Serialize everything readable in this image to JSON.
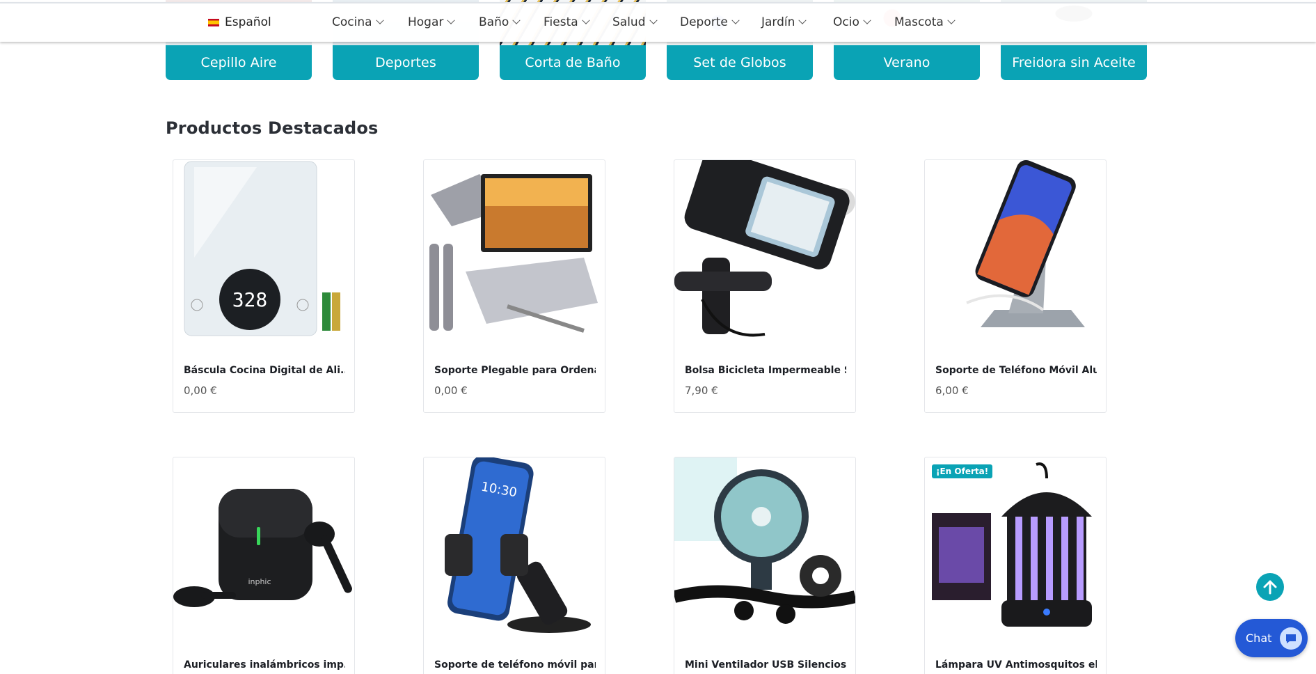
{
  "nav": {
    "language": "Español",
    "items": [
      {
        "label": "Cocina"
      },
      {
        "label": "Hogar"
      },
      {
        "label": "Baño"
      },
      {
        "label": "Fiesta"
      },
      {
        "label": "Salud"
      },
      {
        "label": "Deporte"
      },
      {
        "label": "Jardín"
      },
      {
        "label": "Ocio"
      },
      {
        "label": "Mascota"
      }
    ]
  },
  "categories": [
    {
      "label": "Cepillo Aire"
    },
    {
      "label": "Deportes"
    },
    {
      "label": "Corta de Baño"
    },
    {
      "label": "Set de Globos"
    },
    {
      "label": "Verano"
    },
    {
      "label": "Freidora sin Aceite"
    }
  ],
  "featured": {
    "title": "Productos Destacados",
    "products": [
      {
        "name": "Báscula Cocina Digital de Ali...",
        "price": "0,00 €",
        "icon": "kitchen-scale-image"
      },
      {
        "name": "Soporte Plegable para Ordena...",
        "price": "0,00 €",
        "icon": "laptop-stand-image"
      },
      {
        "name": "Bolsa Bicicleta Impermeable S...",
        "price": "7,90 €",
        "icon": "bike-phone-bag-image"
      },
      {
        "name": "Soporte de Teléfono Móvil Alu...",
        "price": "6,00 €",
        "icon": "phone-stand-image"
      },
      {
        "name": "Auriculares inalámbricos imp...",
        "icon": "earbuds-image"
      },
      {
        "name": "Soporte de teléfono móvil par...",
        "icon": "car-phone-mount-image"
      },
      {
        "name": "Mini Ventilador USB Silencioso ...",
        "icon": "mini-fan-image"
      },
      {
        "name": "Lámpara UV Antimosquitos el...",
        "icon": "mosquito-lamp-image",
        "badge": "¡En Oferta!"
      }
    ]
  },
  "floating": {
    "chat_label": "Chat"
  },
  "colors": {
    "accent": "#0aa3b5",
    "chat": "#2459d6"
  }
}
